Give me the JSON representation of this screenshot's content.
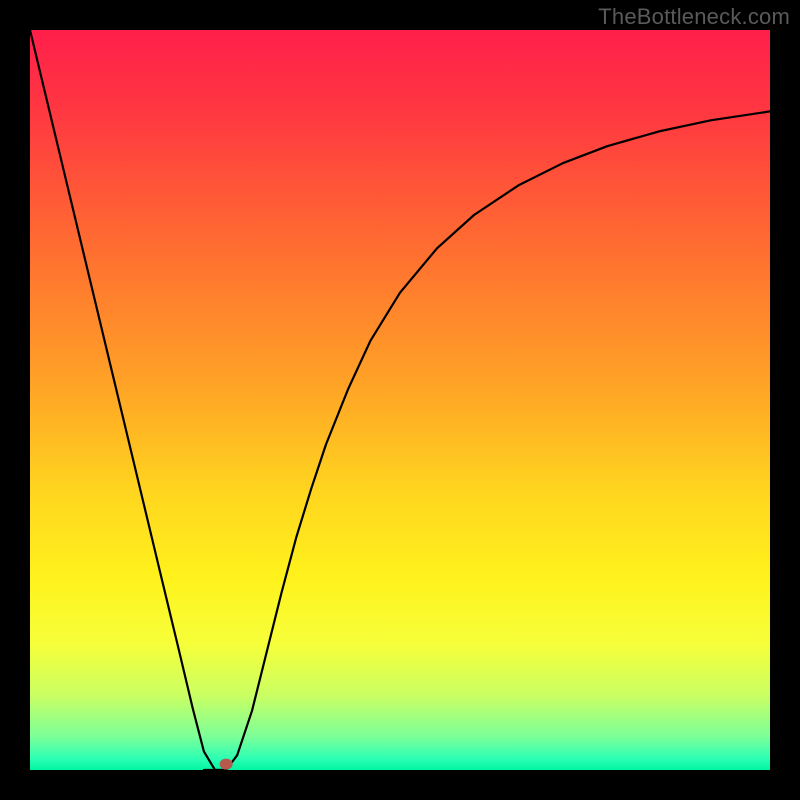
{
  "watermark": "TheBottleneck.com",
  "chart_data": {
    "type": "line",
    "title": "",
    "xlabel": "",
    "ylabel": "",
    "xlim": [
      0,
      100
    ],
    "ylim": [
      0,
      100
    ],
    "grid": false,
    "background": {
      "type": "vertical-gradient",
      "stops": [
        {
          "offset": 0.0,
          "color": "#ff1f4a"
        },
        {
          "offset": 0.12,
          "color": "#ff3a40"
        },
        {
          "offset": 0.3,
          "color": "#ff6f30"
        },
        {
          "offset": 0.48,
          "color": "#ffa326"
        },
        {
          "offset": 0.62,
          "color": "#ffd41f"
        },
        {
          "offset": 0.74,
          "color": "#fff21c"
        },
        {
          "offset": 0.83,
          "color": "#f6ff3a"
        },
        {
          "offset": 0.9,
          "color": "#c9ff63"
        },
        {
          "offset": 0.955,
          "color": "#7bff99"
        },
        {
          "offset": 0.985,
          "color": "#2bffb3"
        },
        {
          "offset": 1.0,
          "color": "#00f5a3"
        }
      ]
    },
    "series": [
      {
        "name": "bottleneck-curve",
        "x": [
          0.0,
          3.0,
          6.0,
          9.0,
          12.0,
          15.0,
          18.0,
          20.0,
          22.0,
          23.5,
          25.0,
          26.5,
          28.0,
          30.0,
          32.0,
          34.0,
          36.0,
          38.0,
          40.0,
          43.0,
          46.0,
          50.0,
          55.0,
          60.0,
          66.0,
          72.0,
          78.0,
          85.0,
          92.0,
          100.0
        ],
        "y": [
          100.0,
          87.5,
          75.0,
          62.5,
          50.0,
          37.5,
          25.0,
          16.7,
          8.3,
          2.5,
          0.0,
          0.0,
          2.0,
          8.0,
          16.0,
          24.0,
          31.5,
          38.0,
          44.0,
          51.5,
          58.0,
          64.5,
          70.5,
          75.0,
          79.0,
          82.0,
          84.3,
          86.3,
          87.8,
          89.0
        ]
      }
    ],
    "flat_segment": {
      "x": [
        23.5,
        26.5
      ],
      "y": 0.0
    },
    "marker": {
      "x": 26.5,
      "y": 0.8,
      "color": "#b65a4e"
    }
  }
}
